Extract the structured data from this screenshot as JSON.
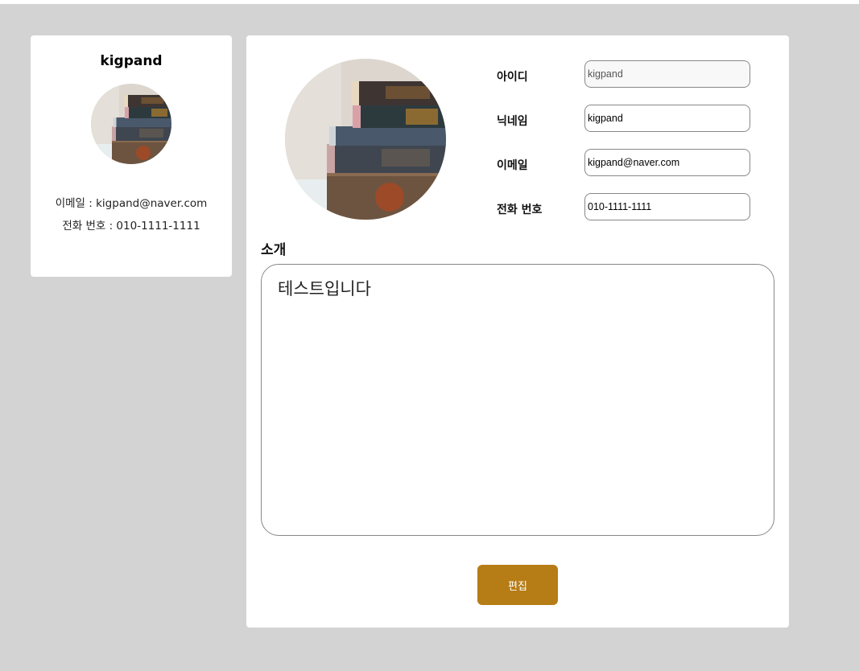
{
  "profile_card": {
    "username": "kigpand",
    "email_line": "이메일 : kigpand@naver.com",
    "phone_line": "전화 번호 : 010-1111-1111"
  },
  "form": {
    "id_label": "아이디",
    "id_value": "kigpand",
    "nickname_label": "닉네임",
    "nickname_value": "kigpand",
    "email_label": "이메일",
    "email_value": "kigpand@naver.com",
    "phone_label": "전화 번호",
    "phone_value": "010-1111-1111",
    "intro_label": "소개",
    "intro_value": "테스트입니다",
    "edit_label": "편집"
  },
  "colors": {
    "background": "#d3d3d3",
    "card": "#ffffff",
    "accent": "#b67c15"
  },
  "icons": {
    "avatar_image": "stack-of-books-photo"
  }
}
